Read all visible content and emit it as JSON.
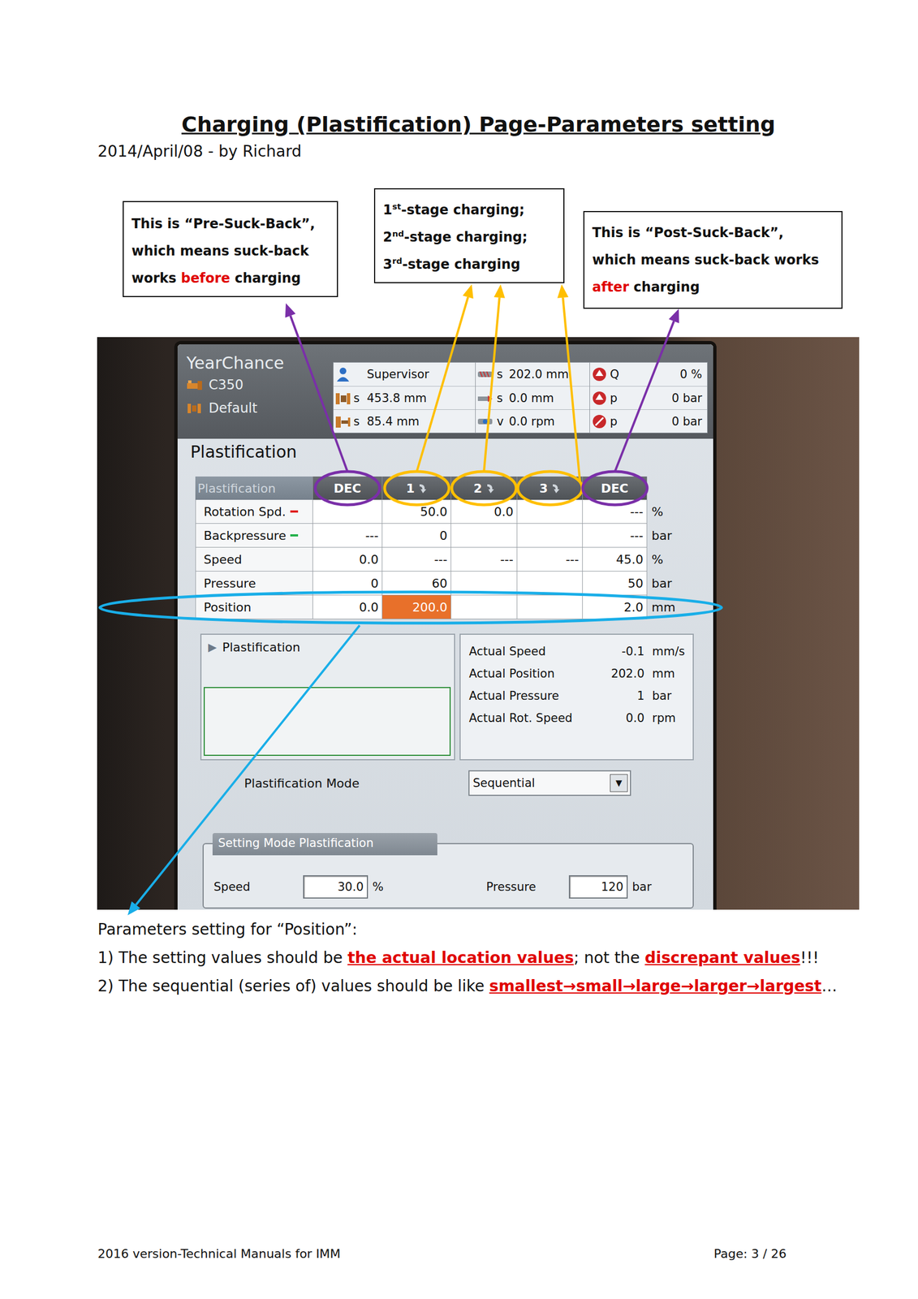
{
  "document": {
    "title": "Charging (Plastification) Page-Parameters setting",
    "byline": "2014/April/08 - by Richard",
    "footer_left": "2016 version-Technical Manuals for IMM",
    "footer_right": "Page: 3 / 26"
  },
  "callouts": [
    {
      "lines": [
        [
          {
            "text": "This is “Pre-Suck-Back”,",
            "kind": "plain"
          }
        ],
        [
          {
            "text": "which means suck-back",
            "kind": "plain"
          }
        ],
        [
          {
            "text": "works ",
            "kind": "plain"
          },
          {
            "text": "before",
            "kind": "red"
          },
          {
            "text": " charging",
            "kind": "plain"
          }
        ]
      ]
    },
    {
      "lines": [
        [
          {
            "text": "1",
            "kind": "plain"
          },
          {
            "text": "st",
            "kind": "sup"
          },
          {
            "text": "-stage charging;",
            "kind": "plain"
          }
        ],
        [
          {
            "text": "2",
            "kind": "plain"
          },
          {
            "text": "nd",
            "kind": "sup"
          },
          {
            "text": "-stage charging;",
            "kind": "plain"
          }
        ],
        [
          {
            "text": "3",
            "kind": "plain"
          },
          {
            "text": "rd",
            "kind": "sup"
          },
          {
            "text": "-stage charging",
            "kind": "plain"
          }
        ]
      ]
    },
    {
      "lines": [
        [
          {
            "text": "This is “Post-Suck-Back”,",
            "kind": "plain"
          }
        ],
        [
          {
            "text": "which means suck-back works",
            "kind": "plain"
          }
        ],
        [
          {
            "text": "after",
            "kind": "red"
          },
          {
            "text": " charging",
            "kind": "plain"
          }
        ]
      ]
    }
  ],
  "hmi": {
    "brand": "YearChance",
    "machine": "C350",
    "mold": "Default",
    "status": [
      [
        {
          "label": "",
          "value": "Supervisor"
        },
        {
          "label": "s",
          "value": "453.8 mm"
        },
        {
          "label": "s",
          "value": "85.4 mm"
        }
      ],
      [
        {
          "label": "s",
          "value": "202.0 mm"
        },
        {
          "label": "s",
          "value": "0.0 mm"
        },
        {
          "label": "v",
          "value": "0.0 rpm"
        }
      ],
      [
        {
          "label": "Q",
          "value": "0 %"
        },
        {
          "label": "p",
          "value": "0 bar"
        },
        {
          "label": "p",
          "value": "0 bar"
        }
      ]
    ],
    "page_title": "Plastification",
    "table": {
      "columns": [
        {
          "label": "Plastification",
          "kind": "tab"
        },
        {
          "label": "DEC",
          "kind": "dec"
        },
        {
          "label": "1",
          "kind": "stage"
        },
        {
          "label": "2",
          "kind": "stage"
        },
        {
          "label": "3",
          "kind": "stage"
        },
        {
          "label": "DEC",
          "kind": "dec"
        }
      ],
      "rows": [
        {
          "label": "Rotation Spd.",
          "color": "#e02020",
          "cells": [
            {
              "text": "",
              "selected": false
            },
            {
              "text": "50.0",
              "selected": false
            },
            {
              "text": "0.0",
              "selected": false
            },
            {
              "text": "",
              "selected": false
            },
            {
              "text": "---",
              "selected": false
            }
          ],
          "unit": "%"
        },
        {
          "label": "Backpressure",
          "color": "#22b04a",
          "cells": [
            {
              "text": "---",
              "selected": false
            },
            {
              "text": "0",
              "selected": false
            },
            {
              "text": "",
              "selected": false
            },
            {
              "text": "",
              "selected": false
            },
            {
              "text": "---",
              "selected": false
            }
          ],
          "unit": "bar"
        },
        {
          "label": "Speed",
          "cells": [
            {
              "text": "0.0",
              "selected": false
            },
            {
              "text": "---",
              "selected": false
            },
            {
              "text": "---",
              "selected": false
            },
            {
              "text": "---",
              "selected": false
            },
            {
              "text": "45.0",
              "selected": false
            }
          ],
          "unit": "%"
        },
        {
          "label": "Pressure",
          "cells": [
            {
              "text": "0",
              "selected": false
            },
            {
              "text": "60",
              "selected": false
            },
            {
              "text": "",
              "selected": false
            },
            {
              "text": "",
              "selected": false
            },
            {
              "text": "50",
              "selected": false
            }
          ],
          "unit": "bar"
        },
        {
          "label": "Position",
          "cells": [
            {
              "text": "0.0",
              "selected": false
            },
            {
              "text": "200.0",
              "selected": true
            },
            {
              "text": "",
              "selected": false
            },
            {
              "text": "",
              "selected": false
            },
            {
              "text": "2.0",
              "selected": false
            }
          ],
          "unit": "mm"
        }
      ]
    },
    "panel_arrow": "▶",
    "panel_title": "Plastification",
    "actual": [
      {
        "label": "Actual Speed",
        "value": "-0.1",
        "unit": "mm/s"
      },
      {
        "label": "Actual Position",
        "value": "202.0",
        "unit": "mm"
      },
      {
        "label": "Actual Pressure",
        "value": "1",
        "unit": "bar"
      },
      {
        "label": "Actual Rot. Speed",
        "value": "0.0",
        "unit": "rpm"
      }
    ],
    "mode": {
      "label": "Plastification Mode",
      "value": "Sequential",
      "arrow": "▼"
    },
    "setting": {
      "title": "Setting Mode Plastification",
      "fields": [
        {
          "label": "Speed",
          "value": "30.0",
          "unit": "%"
        },
        {
          "label": "Pressure",
          "value": "120",
          "unit": "bar"
        }
      ]
    }
  },
  "notes": {
    "heading": "Parameters setting for “Position”:",
    "lines": [
      [
        {
          "text": "1) The setting values should be ",
          "kind": "plain"
        },
        {
          "text": "the actual location values",
          "kind": "emph"
        },
        {
          "text": "; not the ",
          "kind": "plain"
        },
        {
          "text": "discrepant values",
          "kind": "emph"
        },
        {
          "text": "!!!",
          "kind": "plain"
        }
      ],
      [
        {
          "text": "2) The sequential (series of) values should be like ",
          "kind": "plain"
        },
        {
          "text": "smallest→small→large→larger→largest",
          "kind": "emph"
        },
        {
          "text": "…",
          "kind": "plain"
        }
      ]
    ]
  }
}
